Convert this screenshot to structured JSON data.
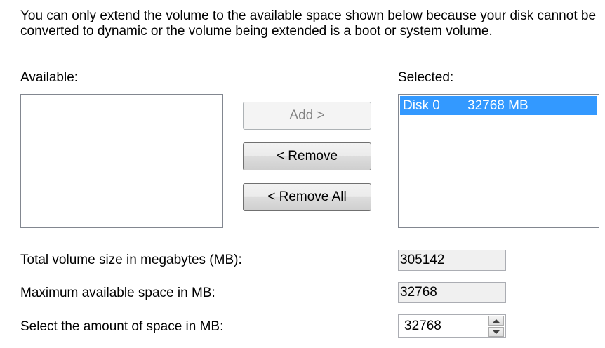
{
  "description": "You can only extend the volume to the available space shown below because your disk cannot be converted to dynamic or the volume being extended is a boot or system volume.",
  "available": {
    "label": "Available:",
    "items": []
  },
  "selected": {
    "label": "Selected:",
    "items": [
      {
        "disk": "Disk 0",
        "size": "32768 MB"
      }
    ]
  },
  "buttons": {
    "add": "Add >",
    "remove": "< Remove",
    "remove_all": "< Remove All"
  },
  "fields": {
    "total_label": "Total volume size in megabytes (MB):",
    "total_value": "305142",
    "max_label": "Maximum available space in MB:",
    "max_value": "32768",
    "select_label": "Select the amount of space in MB:",
    "select_value": "32768"
  },
  "icons": {
    "spin_up": "spin-up-icon",
    "spin_down": "spin-down-icon"
  },
  "colors": {
    "selection": "#3399ff",
    "button_disabled_text": "#838383",
    "readonly_background": "#f0f0f0"
  }
}
